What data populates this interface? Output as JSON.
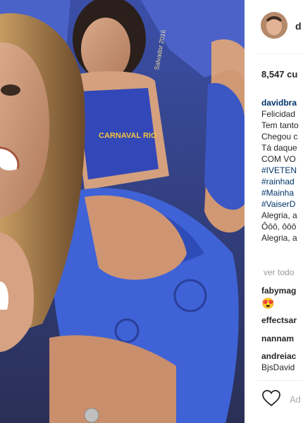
{
  "post": {
    "username": "d",
    "likes": "8,547 cu",
    "caption": {
      "username": "davidbra",
      "lines": [
        {
          "text": "Felicidad",
          "tag": false
        },
        {
          "text": "Tem tanto",
          "tag": false
        },
        {
          "text": "Chegou c",
          "tag": false
        },
        {
          "text": "Tá daque",
          "tag": false
        },
        {
          "text": "COM VO",
          "tag": false
        },
        {
          "text": "#IVETEN",
          "tag": true
        },
        {
          "text": "#rainhad",
          "tag": true
        },
        {
          "text": "#Mainha",
          "tag": true
        },
        {
          "text": "#VaiserD",
          "tag": true
        },
        {
          "text": "Alegria, a",
          "tag": false
        },
        {
          "text": "Ôôô, ôôô",
          "tag": false
        },
        {
          "text": "Alegria, a",
          "tag": false
        }
      ]
    },
    "view_all": "ver todo",
    "comments": [
      {
        "user": "fabymag",
        "text": "😍"
      },
      {
        "user": "effectsar",
        "text": ""
      },
      {
        "user": "nannam",
        "text": ""
      },
      {
        "user": "andreiac",
        "text": "BjsDavid"
      }
    ],
    "add_comment_placeholder": "Ad"
  },
  "photo": {
    "shirt_text": "CARNAVAL RIO",
    "shirt_text_2": "Salvador 2016"
  }
}
